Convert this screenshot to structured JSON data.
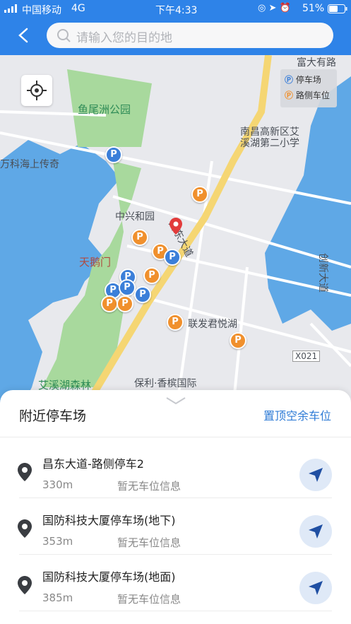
{
  "status_bar": {
    "carrier": "中国移动",
    "network": "4G",
    "time": "下午4:33",
    "battery": "51%"
  },
  "search": {
    "placeholder": "请输入您的目的地"
  },
  "map": {
    "legend": {
      "parking_lot": "停车场",
      "roadside": "路侧车位"
    },
    "pin_glyph": "P",
    "labels": {
      "park": "鱼尾洲公园",
      "school": "南昌高新区艾\n溪湖第二小学",
      "school_line1": "南昌高新区艾",
      "school_line2": "溪湖第二小学",
      "top_right": "富大有路",
      "left_edge": "万科海上传奇",
      "zhongxing": "中兴和园",
      "tiane": "天鹅门",
      "road_changdong": "昌东大道",
      "lianfa": "联发君悦湖",
      "road_chuangxin": "创新大道",
      "x021": "X021",
      "aixihu": "艾溪湖森林",
      "baoli": "保利·香槟国际"
    }
  },
  "sheet": {
    "title": "附近停车场",
    "action": "置顶空余车位",
    "items": [
      {
        "name": "昌东大道-路侧停车2",
        "distance": "330m",
        "info": "暂无车位信息"
      },
      {
        "name": "国防科技大厦停车场(地下)",
        "distance": "353m",
        "info": "暂无车位信息"
      },
      {
        "name": "国防科技大厦停车场(地面)",
        "distance": "385m",
        "info": "暂无车位信息"
      }
    ]
  },
  "colors": {
    "brand": "#2e83e8",
    "parking_blue": "#3b7fd9",
    "parking_orange": "#f0902d",
    "water": "#5fa8e6",
    "park": "#a8d99d",
    "road_main": "#f5d673"
  },
  "icons": [
    "back-arrow-icon",
    "search-icon",
    "locate-icon",
    "map-pin-icon",
    "navigate-arrow-icon",
    "chevron-down-icon",
    "signal-icon",
    "battery-icon"
  ]
}
